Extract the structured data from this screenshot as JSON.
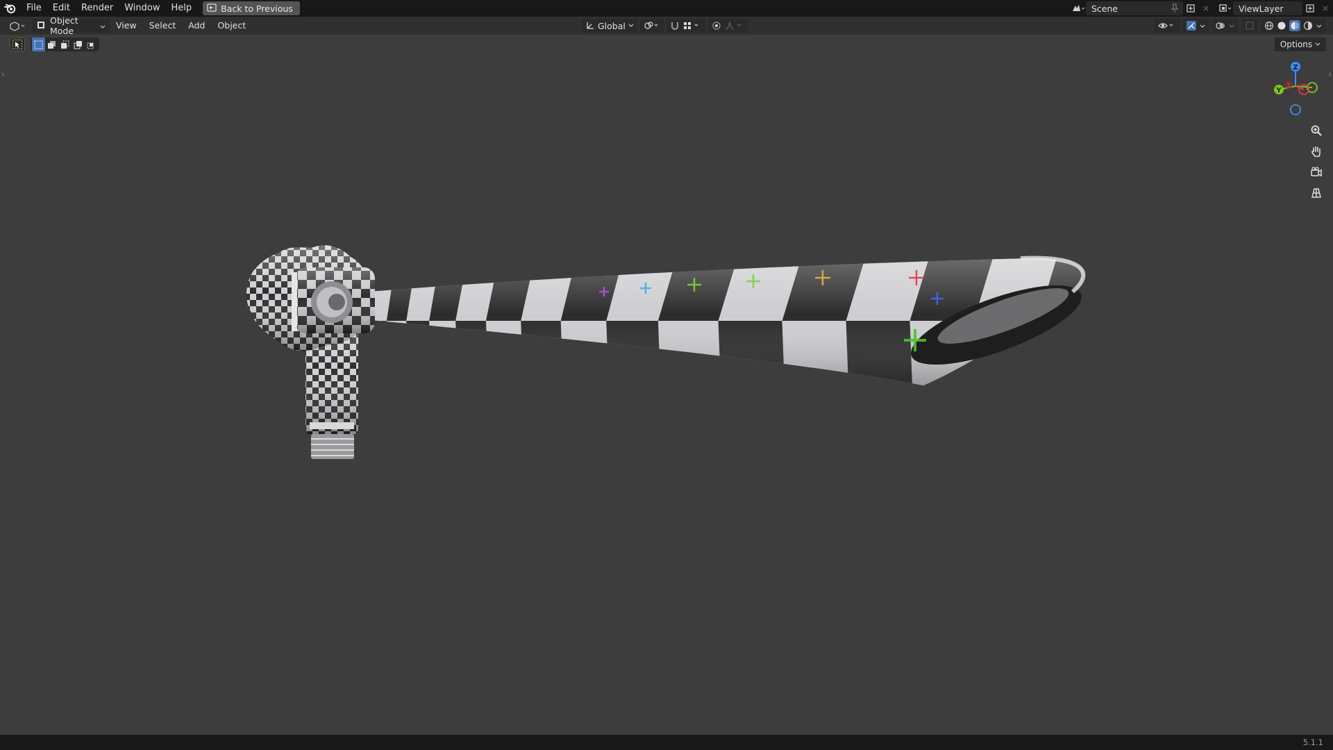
{
  "topbar": {
    "menus": [
      "File",
      "Edit",
      "Render",
      "Window",
      "Help"
    ],
    "back_label": "Back to Previous",
    "scene_label": "Scene",
    "viewlayer_label": "ViewLayer"
  },
  "viewport_header": {
    "mode_label": "Object Mode",
    "menus": [
      "View",
      "Select",
      "Add",
      "Object"
    ],
    "transform_orientation": "Global"
  },
  "tools": {
    "options_label": "Options"
  },
  "gizmo": {
    "z": "Z",
    "y": "Y",
    "x": "X"
  },
  "statusbar": {
    "version": "5.1.1"
  },
  "icons": {
    "logo": "blender-logo-icon",
    "back": "back-to-previous-icon",
    "zoom": "zoom-icon",
    "pan": "hand-pan-icon",
    "camera": "camera-view-icon",
    "ortho": "grid-ortho-icon"
  },
  "colors": {
    "viewport_bg": "#3d3d3d",
    "header_bg": "#303030",
    "topbar_bg": "#181818",
    "axis_x": "#e0394b",
    "axis_y": "#84c31b",
    "axis_z": "#3c8ef0"
  }
}
